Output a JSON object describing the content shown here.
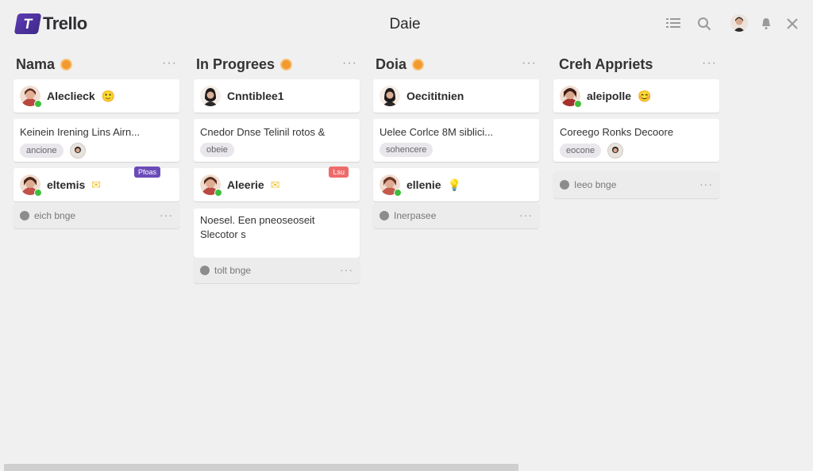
{
  "app": {
    "logo_text": "Trello",
    "logo_letter": "T"
  },
  "header": {
    "board_title": "Daie",
    "icons": [
      "list-icon",
      "search-icon",
      "avatar",
      "bell-icon",
      "close-icon"
    ]
  },
  "colors": {
    "background": "#f0f0f1",
    "logo": "#4b2f9c",
    "column_dot": "#f29a2e",
    "online_status": "#3cbf3c",
    "label_purple": "#6b4bb8",
    "label_red": "#ef6b6b"
  },
  "columns": [
    {
      "title": "Nama",
      "menu": "···",
      "user_card_1": {
        "name": "Aleclieck",
        "emoji": "🙂"
      },
      "task_card": {
        "text": "Keinein Irening Lins Airn...",
        "pill": "ancione"
      },
      "user_card_2": {
        "name": "eltemis",
        "emoji": "✉",
        "label": "Pfoas"
      },
      "slot": {
        "label": "eich bnge"
      }
    },
    {
      "title": "In Progrees",
      "menu": "···",
      "user_card_1": {
        "name": "Cnntiblee1"
      },
      "task_card": {
        "text": "Cnedor Dnse Telinil rotos &",
        "pill": "obeie"
      },
      "user_card_2": {
        "name": "Aleerie",
        "emoji": "✉",
        "label": "Lsu"
      },
      "task_card_2": {
        "line1": "Noesel. Een pneoseoseit",
        "line2": "Slecotor s"
      },
      "slot": {
        "label": "tolt bnge"
      }
    },
    {
      "title": "Doia",
      "menu": "···",
      "user_card_1": {
        "name": "Oecititnien"
      },
      "task_card": {
        "text": "Uelee Corlce 8M siblici...",
        "pill": "sohencere"
      },
      "user_card_2": {
        "name": "ellenie",
        "emoji": "💡"
      },
      "slot": {
        "label": "Inerpasee"
      }
    },
    {
      "title": "Creh Appriets",
      "menu": "···",
      "user_card_1": {
        "name": "aleipolle",
        "emoji": "😊"
      },
      "task_card": {
        "text": "Coreego Ronks Decoore",
        "pill": "eocone"
      },
      "slot": {
        "label": "Ieeo bnge"
      }
    }
  ],
  "scrollbar": {
    "thumb_fraction": 0.64
  }
}
